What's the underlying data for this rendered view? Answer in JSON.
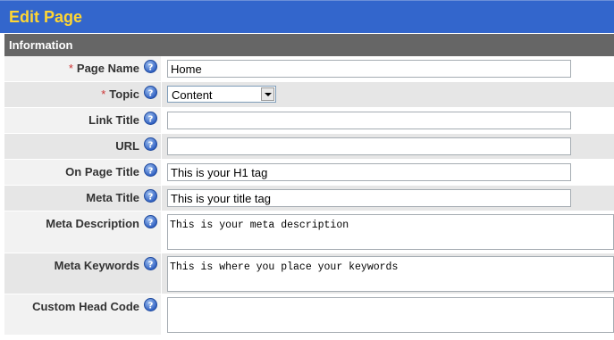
{
  "header": {
    "title": "Edit Page"
  },
  "section": {
    "title": "Information"
  },
  "form": {
    "required_mark": "*",
    "page_name": {
      "label": "Page Name",
      "value": "Home"
    },
    "topic": {
      "label": "Topic",
      "value": "Content"
    },
    "link_title": {
      "label": "Link Title",
      "value": ""
    },
    "url": {
      "label": "URL",
      "value": ""
    },
    "on_page_title": {
      "label": "On Page Title",
      "value": "This is your H1 tag"
    },
    "meta_title": {
      "label": "Meta Title",
      "value": "This is your title tag"
    },
    "meta_description": {
      "label": "Meta Description",
      "value": "This is your meta description"
    },
    "meta_keywords": {
      "label": "Meta Keywords",
      "value": "This is where you place your keywords"
    },
    "custom_head_code": {
      "label": "Custom Head Code",
      "value": ""
    }
  },
  "colors": {
    "title_bar": "#3366cc",
    "title_text": "#ffd633",
    "section_bar": "#666666",
    "required": "#cc3333",
    "help_icon": "#3366cc"
  },
  "icons": {
    "help": "help-icon",
    "dropdown": "chevron-down-icon"
  }
}
